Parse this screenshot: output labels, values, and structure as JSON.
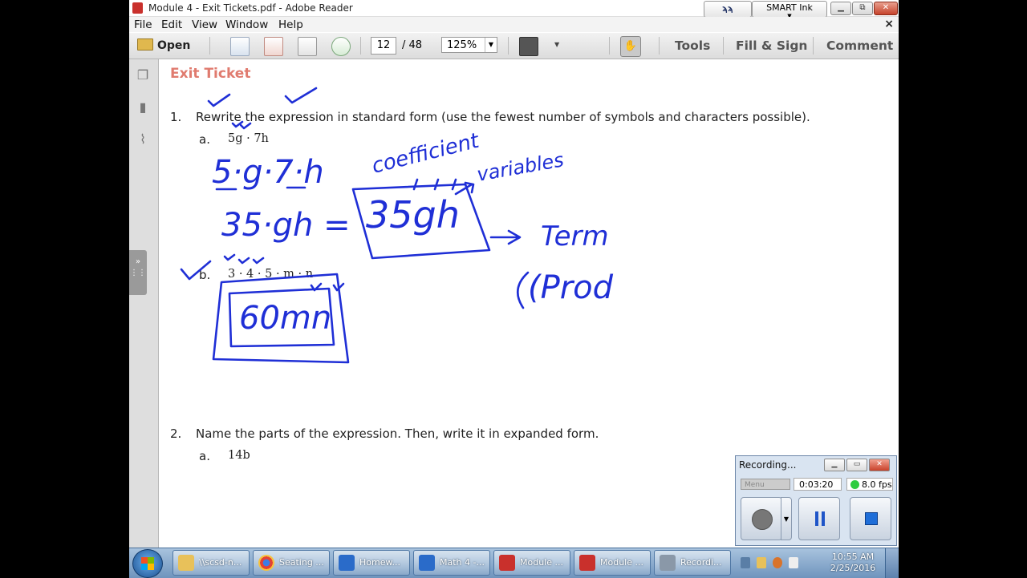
{
  "window": {
    "title": "Module 4 - Exit Tickets.pdf - Adobe Reader",
    "smart_ink_label": "SMART Ink",
    "close_label": "✕",
    "minimize_label": "▭",
    "restore_label": "⧉"
  },
  "menu": {
    "items": [
      "File",
      "Edit",
      "View",
      "Window",
      "Help"
    ],
    "close_doc": "×"
  },
  "toolbar": {
    "open_label": "Open",
    "current_page": "12",
    "total_pages": "/  48",
    "zoom": "125%",
    "tools_label": "Tools",
    "fill_sign_label": "Fill & Sign",
    "comment_label": "Comment"
  },
  "document": {
    "heading": "Exit Ticket",
    "q1": {
      "number": "1.",
      "text": "Rewrite the expression in standard form (use the fewest number of symbols and characters possible).",
      "a_label": "a.",
      "a_expr": "5g · 7h",
      "b_label": "b.",
      "b_expr": "3 · 4 · 5 · m · n"
    },
    "q2": {
      "number": "2.",
      "text": "Name the parts of the expression.  Then, write it in expanded form.",
      "a_label": "a.",
      "a_expr": "14b"
    },
    "ink": {
      "line1": "5·g·7·h",
      "line2": "35·gh =",
      "boxed1": "35gh",
      "coefficient": "coefficient",
      "variables": "variables",
      "term": "Term",
      "prod": "(Prod",
      "boxed2": "60mn"
    }
  },
  "recorder": {
    "title": "Recording...",
    "menu_label": "Menu",
    "elapsed": "0:03:20",
    "fps": "8.0 fps"
  },
  "taskbar": {
    "tasks": [
      {
        "label": "\\\\scsd-n..."
      },
      {
        "label": "Seating ..."
      },
      {
        "label": "Homew..."
      },
      {
        "label": "Math 4 -..."
      },
      {
        "label": "Module ..."
      },
      {
        "label": "Module ..."
      },
      {
        "label": "Recordi..."
      }
    ],
    "time": "10:55 AM",
    "date": "2/25/2016"
  },
  "colors": {
    "heading": "#e07b6f",
    "ink": "#1f2fd6",
    "taskbar": "#8fb0d2"
  }
}
